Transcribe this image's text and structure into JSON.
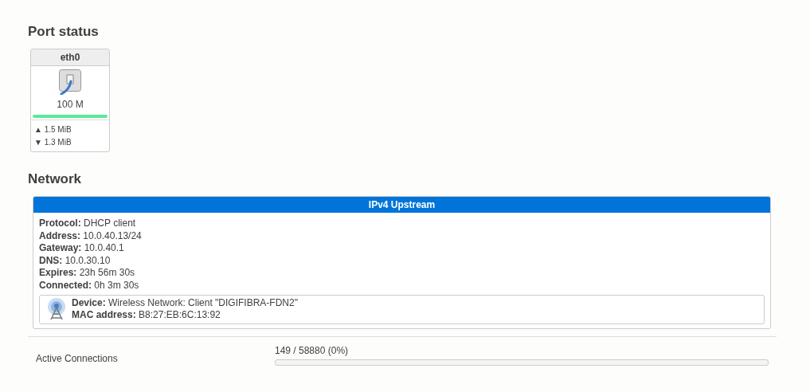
{
  "port_status": {
    "title": "Port status",
    "ports": [
      {
        "name": "eth0",
        "speed": "100 M",
        "connected": true,
        "tx": {
          "arrow": "▲",
          "amount": "1.5 MiB"
        },
        "rx": {
          "arrow": "▼",
          "amount": "1.3 MiB"
        }
      }
    ]
  },
  "network": {
    "title": "Network",
    "panel_title": "IPv4 Upstream",
    "fields": [
      "**Protocol:** DHCP client",
      "**Address:** 10.0.40.13/24",
      "**Gateway:** 10.0.40.1",
      "**DNS:** 10.0.30.10",
      "**Expires:** 23h 56m 30s",
      "**Connected:** 0h 3m 30s"
    ],
    "device": [
      "**Device:** Wireless Network: Client \"DIGIFIBRA-FDN2\"",
      "**MAC address:** B8:27:EB:6C:13:92"
    ]
  },
  "connections": {
    "label": "Active Connections",
    "reading": "149 / 58880 (0%)",
    "level": 0
  }
}
